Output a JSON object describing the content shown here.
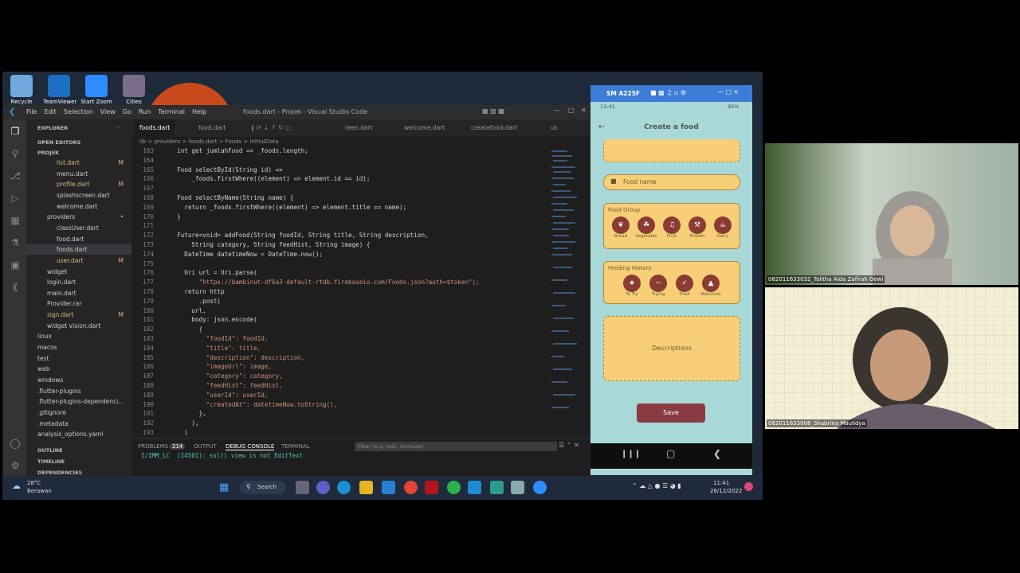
{
  "desktop_icons": [
    {
      "label": "Recycle Bin",
      "color": "#6fa8dc"
    },
    {
      "label": "TeamViewer",
      "color": "#1b6ec2"
    },
    {
      "label": "Start Zoom",
      "color": "#2d8cff"
    },
    {
      "label": "Cities",
      "color": "#7a6d8a"
    }
  ],
  "vscode": {
    "title": "foods.dart - Projek - Visual Studio Code",
    "menu": [
      "File",
      "Edit",
      "Selection",
      "View",
      "Go",
      "Run",
      "Terminal",
      "Help"
    ],
    "explorer_label": "EXPLORER",
    "open_editors": "OPEN EDITORS",
    "project": "PROJEK",
    "tree": [
      {
        "label": "list.dart",
        "mark": "M",
        "indent": 1
      },
      {
        "label": "menu.dart",
        "mark": "",
        "indent": 1
      },
      {
        "label": "profile.dart",
        "mark": "M",
        "indent": 1
      },
      {
        "label": "splashscreen.dart",
        "mark": "",
        "indent": 1
      },
      {
        "label": "welcome.dart",
        "mark": "",
        "indent": 1
      },
      {
        "label": "providers",
        "mark": "•",
        "indent": 0
      },
      {
        "label": "classUser.dart",
        "mark": "",
        "indent": 1
      },
      {
        "label": "food.dart",
        "mark": "",
        "indent": 1
      },
      {
        "label": "foods.dart",
        "mark": "",
        "indent": 1,
        "selected": true
      },
      {
        "label": "user.dart",
        "mark": "M",
        "indent": 1
      },
      {
        "label": "widget",
        "mark": "",
        "indent": 0
      },
      {
        "label": "login.dart",
        "mark": "",
        "indent": 0
      },
      {
        "label": "main.dart",
        "mark": "",
        "indent": 0
      },
      {
        "label": "Provider.rar",
        "mark": "",
        "indent": 0
      },
      {
        "label": "sign.dart",
        "mark": "M",
        "indent": 0
      },
      {
        "label": "widget vision.dart",
        "mark": "",
        "indent": 0
      },
      {
        "label": "linux",
        "mark": "",
        "indent": -1
      },
      {
        "label": "macos",
        "mark": "",
        "indent": -1
      },
      {
        "label": "test",
        "mark": "",
        "indent": -1
      },
      {
        "label": "web",
        "mark": "",
        "indent": -1
      },
      {
        "label": "windows",
        "mark": "",
        "indent": -1
      },
      {
        "label": ".flutter-plugins",
        "mark": "",
        "indent": -1
      },
      {
        "label": ".flutter-plugins-dependenci...",
        "mark": "",
        "indent": -1
      },
      {
        "label": ".gitignore",
        "mark": "",
        "indent": -1
      },
      {
        "label": ".metadata",
        "mark": "",
        "indent": -1
      },
      {
        "label": "analysis_options.yaml",
        "mark": "",
        "indent": -1
      }
    ],
    "outline": "OUTLINE",
    "timeline": "TIMELINE",
    "dependencies": "DEPENDENCIES",
    "tabs": [
      "foods.dart",
      "food.dart",
      "reen.dart",
      "welcome.dart",
      "createfood.dart",
      "us"
    ],
    "breadcrumb": "lib > providers > foods.dart > Foods > initialData",
    "lines": [
      {
        "n": "163",
        "t": "  int get jumlahFood => _foods.length;"
      },
      {
        "n": "164",
        "t": ""
      },
      {
        "n": "165",
        "t": "  Food selectById(String id) =>"
      },
      {
        "n": "166",
        "t": "      _foods.firstWhere((element) => element.id == id);"
      },
      {
        "n": "167",
        "t": ""
      },
      {
        "n": "168",
        "t": "  Food selectByName(String name) {"
      },
      {
        "n": "169",
        "t": "    return _foods.firstWhere((element) => element.title == name);"
      },
      {
        "n": "170",
        "t": "  }"
      },
      {
        "n": "171",
        "t": ""
      },
      {
        "n": "172",
        "t": "  Future<void> addFood(String foodId, String title, String description,"
      },
      {
        "n": "173",
        "t": "      String category, String feedHist, String image) {"
      },
      {
        "n": "174",
        "t": "    DateTime datetimeNow = DateTime.now();"
      },
      {
        "n": "175",
        "t": ""
      },
      {
        "n": "176",
        "t": "    Uri url = Uri.parse("
      },
      {
        "n": "177",
        "t": "        \"https://bambinut-df6a3-default-rtdb.firebaseio.com/Foods.json?auth=$token\");"
      },
      {
        "n": "178",
        "t": "    return http"
      },
      {
        "n": "179",
        "t": "        .post("
      },
      {
        "n": "180",
        "t": "      url,"
      },
      {
        "n": "181",
        "t": "      body: json.encode("
      },
      {
        "n": "182",
        "t": "        {"
      },
      {
        "n": "183",
        "t": "          \"foodId\": foodId,"
      },
      {
        "n": "184",
        "t": "          \"title\": title,"
      },
      {
        "n": "185",
        "t": "          \"description\": description,"
      },
      {
        "n": "186",
        "t": "          \"imageUrl\": image,"
      },
      {
        "n": "187",
        "t": "          \"category\": category,"
      },
      {
        "n": "188",
        "t": "          \"feedHist\": feedHist,"
      },
      {
        "n": "189",
        "t": "          \"userId\": userId,"
      },
      {
        "n": "190",
        "t": "          \"createdAt\": datetimeNow.toString(),"
      },
      {
        "n": "191",
        "t": "        },"
      },
      {
        "n": "192",
        "t": "      ),"
      },
      {
        "n": "193",
        "t": "    )"
      }
    ],
    "panel_tabs": [
      "PROBLEMS",
      "214",
      "OUTPUT",
      "DEBUG CONSOLE",
      "TERMINAL"
    ],
    "filter_placeholder": "Filter (e.g. text, !exclude)",
    "terminal_lines": [
      "I/IMM_LC  (14501): ssl() view is not EditText"
    ]
  },
  "phone": {
    "device": "SM A225F",
    "time": "11:41",
    "battery": "95%",
    "screen_title": "Create a food",
    "food_name_placeholder": "Food name",
    "food_group_label": "Food Group",
    "food_groups": [
      "Bread",
      "Vegetable",
      "Fruit",
      "Protein",
      "Dairy"
    ],
    "feeding_history_label": "Feeding History",
    "feeding_items": [
      "To Try",
      "Trying",
      "Tried",
      "Watchlist"
    ],
    "description_placeholder": "Descriptions",
    "save_label": "Save"
  },
  "taskbar": {
    "temperature": "28°C",
    "weather": "Berawan",
    "search": "Search",
    "time": "11:41",
    "date": "26/12/2022"
  },
  "participants": [
    {
      "name": "082011633032_Talitha Alda Zafirah Dewi"
    },
    {
      "name": "082011633008_Shabrina Maulidya"
    }
  ]
}
